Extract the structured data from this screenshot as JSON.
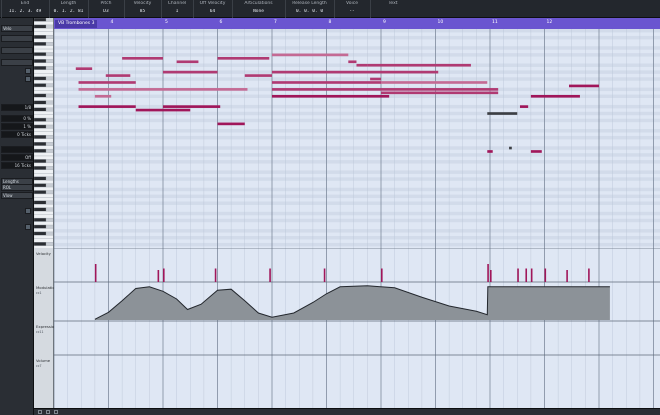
{
  "info_line": [
    {
      "label": "End",
      "value": "11. 2. 3. 49"
    },
    {
      "label": "Length",
      "value": "0. 1. 2. 81"
    },
    {
      "label": "Pitch",
      "value": "D3"
    },
    {
      "label": "Velocity",
      "value": "85"
    },
    {
      "label": "Channel",
      "value": "1"
    },
    {
      "label": "Off Velocity",
      "value": "64"
    },
    {
      "label": "Articulations",
      "value": "None"
    },
    {
      "label": "Release Length",
      "value": "0. 0. 0. 0"
    },
    {
      "label": "Voice",
      "value": "--"
    },
    {
      "label": "Text",
      "value": ""
    }
  ],
  "inspector": {
    "rows": [
      {
        "label": "Velo",
        "right": ""
      },
      {
        "label": "",
        "right": ""
      },
      {
        "label": "",
        "right": ""
      },
      {
        "label": "",
        "right": ""
      },
      {
        "label": "",
        "right": "1/8"
      },
      {
        "label": "",
        "right": "0 %"
      },
      {
        "label": "",
        "right": "1 %"
      },
      {
        "label": "",
        "right": "0 Ticks"
      },
      {
        "label": "",
        "right": ""
      },
      {
        "label": "",
        "right": "Off"
      },
      {
        "label": "",
        "right": "16 Ticks"
      },
      {
        "label": "Lengths",
        "right": ""
      },
      {
        "label": "ROL",
        "right": ""
      },
      {
        "label": "Vlow",
        "right": ""
      }
    ]
  },
  "part_name": "VB Trombones 3",
  "ruler": {
    "bars": [
      "4",
      "5",
      "6",
      "7",
      "8",
      "9",
      "10",
      "11",
      "12"
    ]
  },
  "lanes": [
    {
      "name": "Velocity",
      "sub": ""
    },
    {
      "name": "Modulation",
      "sub": "cc1"
    },
    {
      "name": "Expression",
      "sub": "cc11"
    },
    {
      "name": "Volume",
      "sub": "cc7"
    }
  ],
  "colors": {
    "grid_bg": "#dfe7f4",
    "ruler": "#6a55d0",
    "note_dark": "#a0165a",
    "note_mid": "#b03a72",
    "note_light": "#c46a94",
    "note_grey": "#3c3f44",
    "mod_fill": "#8c9298"
  },
  "notes": [
    {
      "start": 3.75,
      "len": 0.3,
      "pitch": 61,
      "vel": "light"
    },
    {
      "start": 3.4,
      "len": 0.3,
      "pitch": 69,
      "vel": "mid"
    },
    {
      "start": 3.45,
      "len": 1.05,
      "pitch": 65,
      "vel": "mid"
    },
    {
      "start": 3.45,
      "len": 1.05,
      "pitch": 58,
      "vel": "dark"
    },
    {
      "start": 3.95,
      "len": 0.45,
      "pitch": 67,
      "vel": "mid"
    },
    {
      "start": 3.45,
      "len": 3.1,
      "pitch": 63,
      "vel": "light"
    },
    {
      "start": 4.25,
      "len": 0.75,
      "pitch": 72,
      "vel": "mid"
    },
    {
      "start": 4.5,
      "len": 1.0,
      "pitch": 57,
      "vel": "dark"
    },
    {
      "start": 5.0,
      "len": 1.0,
      "pitch": 68,
      "vel": "mid"
    },
    {
      "start": 5.25,
      "len": 0.4,
      "pitch": 71,
      "vel": "mid"
    },
    {
      "start": 5.0,
      "len": 1.05,
      "pitch": 58,
      "vel": "dark"
    },
    {
      "start": 6.0,
      "len": 0.5,
      "pitch": 53,
      "vel": "dark"
    },
    {
      "start": 6.0,
      "len": 0.95,
      "pitch": 72,
      "vel": "mid"
    },
    {
      "start": 6.5,
      "len": 0.5,
      "pitch": 67,
      "vel": "mid"
    },
    {
      "start": 7.0,
      "len": 1.4,
      "pitch": 73,
      "vel": "light"
    },
    {
      "start": 7.0,
      "len": 2.0,
      "pitch": 65,
      "vel": "mid"
    },
    {
      "start": 7.0,
      "len": 2.15,
      "pitch": 61,
      "vel": "dark"
    },
    {
      "start": 7.0,
      "len": 4.15,
      "pitch": 63,
      "vel": "mid"
    },
    {
      "start": 7.0,
      "len": 3.05,
      "pitch": 68,
      "vel": "mid"
    },
    {
      "start": 8.4,
      "len": 0.15,
      "pitch": 71,
      "vel": "mid"
    },
    {
      "start": 8.55,
      "len": 0.2,
      "pitch": 70,
      "vel": "mid"
    },
    {
      "start": 8.75,
      "len": 1.9,
      "pitch": 70,
      "vel": "mid"
    },
    {
      "start": 8.8,
      "len": 0.2,
      "pitch": 66,
      "vel": "mid"
    },
    {
      "start": 9.0,
      "len": 2.15,
      "pitch": 62,
      "vel": "mid"
    },
    {
      "start": 9.0,
      "len": 1.95,
      "pitch": 65,
      "vel": "light"
    },
    {
      "start": 10.95,
      "len": 0.55,
      "pitch": 56,
      "vel": "grey"
    },
    {
      "start": 10.95,
      "len": 0.1,
      "pitch": 45,
      "vel": "dark"
    },
    {
      "start": 11.55,
      "len": 0.15,
      "pitch": 58,
      "vel": "dark"
    },
    {
      "start": 11.35,
      "len": 0.05,
      "pitch": 46,
      "vel": "grey"
    },
    {
      "start": 11.75,
      "len": 0.2,
      "pitch": 45,
      "vel": "dark"
    },
    {
      "start": 11.75,
      "len": 0.9,
      "pitch": 61,
      "vel": "dark"
    },
    {
      "start": 12.45,
      "len": 0.55,
      "pitch": 64,
      "vel": "dark"
    }
  ],
  "velocity_stalks": [
    {
      "pos": 3.75,
      "level": 0.6
    },
    {
      "pos": 4.9,
      "level": 0.4
    },
    {
      "pos": 5.0,
      "level": 0.45
    },
    {
      "pos": 5.95,
      "level": 0.45
    },
    {
      "pos": 6.95,
      "level": 0.45
    },
    {
      "pos": 7.95,
      "level": 0.45
    },
    {
      "pos": 9.0,
      "level": 0.45
    },
    {
      "pos": 10.95,
      "level": 0.6
    },
    {
      "pos": 11.0,
      "level": 0.4
    },
    {
      "pos": 11.5,
      "level": 0.45
    },
    {
      "pos": 11.65,
      "level": 0.45
    },
    {
      "pos": 11.75,
      "level": 0.45
    },
    {
      "pos": 12.0,
      "level": 0.45
    },
    {
      "pos": 12.4,
      "level": 0.4
    },
    {
      "pos": 12.8,
      "level": 0.45
    }
  ],
  "modulation_curve": [
    [
      3.75,
      0.02
    ],
    [
      4.0,
      0.22
    ],
    [
      4.25,
      0.55
    ],
    [
      4.5,
      0.9
    ],
    [
      4.75,
      0.95
    ],
    [
      5.0,
      0.82
    ],
    [
      5.25,
      0.6
    ],
    [
      5.45,
      0.3
    ],
    [
      5.7,
      0.45
    ],
    [
      6.0,
      0.85
    ],
    [
      6.25,
      0.88
    ],
    [
      6.5,
      0.55
    ],
    [
      6.75,
      0.2
    ],
    [
      7.0,
      0.08
    ],
    [
      7.4,
      0.2
    ],
    [
      7.75,
      0.5
    ],
    [
      8.0,
      0.75
    ],
    [
      8.25,
      0.95
    ],
    [
      8.75,
      0.98
    ],
    [
      9.25,
      0.92
    ],
    [
      9.75,
      0.65
    ],
    [
      10.25,
      0.4
    ],
    [
      10.75,
      0.25
    ],
    [
      10.95,
      0.15
    ],
    [
      10.96,
      0.95
    ],
    [
      13.2,
      0.95
    ]
  ]
}
